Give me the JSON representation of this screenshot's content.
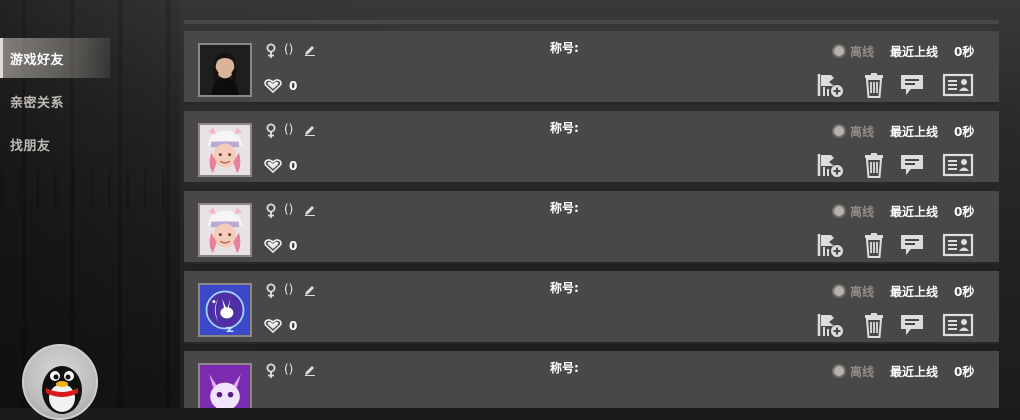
{
  "sidebar": {
    "items": [
      {
        "label": "游戏好友",
        "active": true
      },
      {
        "label": "亲密关系",
        "active": false
      },
      {
        "label": "找朋友",
        "active": false
      }
    ],
    "bottom_avatar": "qq-penguin-icon"
  },
  "friends": [
    {
      "avatar": "female-realistic",
      "gender": "female-icon",
      "name": "()",
      "intimacy": "0",
      "title_label": "称号:",
      "status": "离线",
      "last_online_label": "最近上线",
      "duration": "0秒"
    },
    {
      "avatar": "pink-hat-girl",
      "gender": "female-icon",
      "name": "()",
      "intimacy": "0",
      "title_label": "称号:",
      "status": "离线",
      "last_online_label": "最近上线",
      "duration": "0秒"
    },
    {
      "avatar": "pink-hat-girl",
      "gender": "female-icon",
      "name": "()",
      "intimacy": "0",
      "title_label": "称号:",
      "status": "离线",
      "last_online_label": "最近上线",
      "duration": "0秒"
    },
    {
      "avatar": "rabbit-moon-emblem",
      "gender": "female-icon",
      "name": "()",
      "intimacy": "0",
      "title_label": "称号:",
      "status": "离线",
      "last_online_label": "最近上线",
      "duration": "0秒"
    },
    {
      "avatar": "purple-cat",
      "gender": "female-icon",
      "name": "()",
      "intimacy": "0",
      "title_label": "称号:",
      "status": "离线",
      "last_online_label": "最近上线",
      "duration": "0秒"
    }
  ],
  "actions": [
    "add-to-group-icon",
    "delete-icon",
    "chat-icon",
    "profile-card-icon"
  ],
  "colors": {
    "card_bg": "#4a4847",
    "active_nav": "#d2cdc6",
    "muted_text": "#8e8b88"
  }
}
